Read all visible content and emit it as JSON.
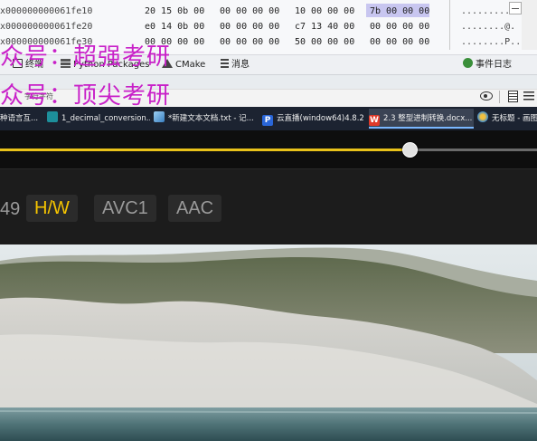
{
  "ide": {
    "hex_rows": [
      {
        "address": "x000000000061fe10",
        "g1": "20 15 0b 00",
        "g2": "00 00 00 00",
        "g3": "10 00 00 00",
        "g4": "7b 00 00 00",
        "ascii": "............"
      },
      {
        "address": "x000000000061fe20",
        "g1": "e0 14 0b 00",
        "g2": "00 00 00 00",
        "g3": "c7 13 40 00",
        "g4": "00 00 00 00",
        "ascii": "........@."
      },
      {
        "address": "x000000000061fe30",
        "g1": "00 00 00 00",
        "g2": "00 00 00 00",
        "g3": "50 00 00 00",
        "g4": "00 00 00 00",
        "ascii": "........P.."
      }
    ],
    "tool_tabs": {
      "terminal": "终端",
      "python_packages": "Python Packages",
      "cmake": "CMake",
      "messages": "消息",
      "event_log": "事件日志"
    },
    "status_small_text": "字符字符"
  },
  "watermark": {
    "line1": "众号：超强考研",
    "line2": "众号：顶尖考研"
  },
  "taskbar": {
    "items": [
      {
        "label": "种语言互...",
        "active": false
      },
      {
        "label": "1_decimal_conversion...",
        "active": false
      },
      {
        "label": "*新建文本文档.txt - 记...",
        "active": false
      },
      {
        "label": "云直播(window64)4.8.2",
        "active": false
      },
      {
        "label": "2.3 整型进制转换.docx...",
        "active": true
      },
      {
        "label": "无标题 - 画图",
        "active": false
      }
    ]
  },
  "player": {
    "seek_progress_percent": 76.2,
    "fps_fragment": "49",
    "badges": [
      {
        "label": "H/W",
        "active": true
      },
      {
        "label": "AVC1",
        "active": false
      },
      {
        "label": "AAC",
        "active": false
      }
    ],
    "accent_color": "#f5c400",
    "seek_fill_color": "#e9c21a"
  }
}
